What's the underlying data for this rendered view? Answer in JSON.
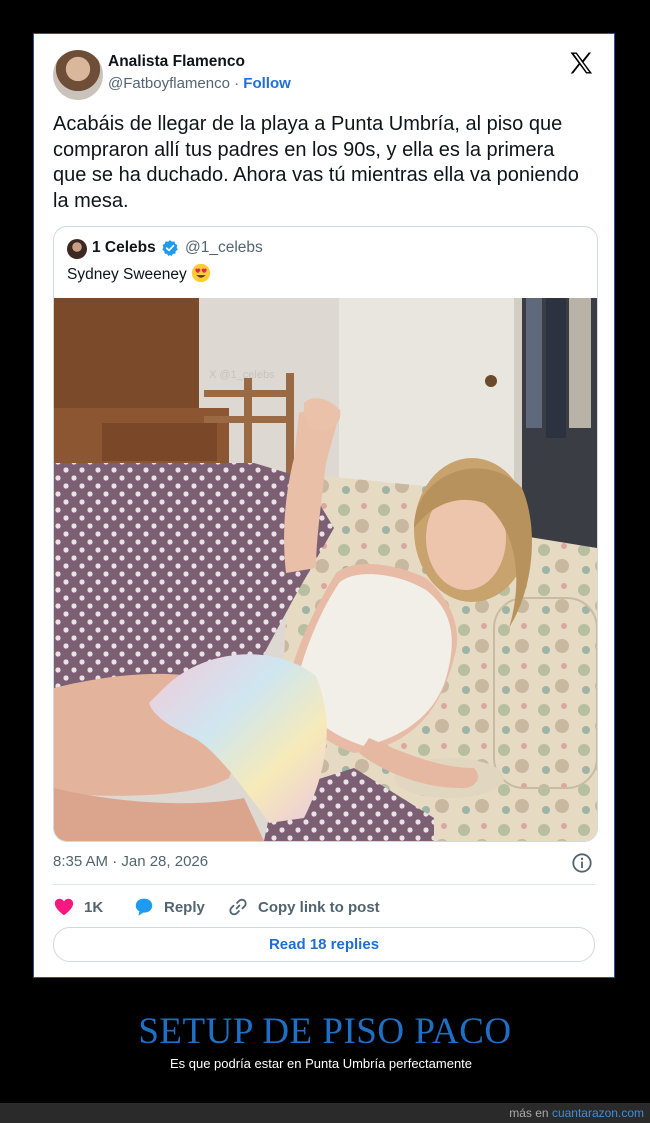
{
  "tweet": {
    "author_name": "Analista Flamenco",
    "author_handle": "@Fatboyflamenco",
    "separator": " · ",
    "follow_label": "Follow",
    "text": "Acabáis de llegar de la playa a Punta Umbría, al piso que compraron allí tus padres en los 90s, y ella es la primera que se ha duchado. Ahora vas tú mientras ella va poniendo la mesa.",
    "quote": {
      "author_name": "1 Celebs",
      "author_handle": "@1_celebs",
      "text": "Sydney Sweeney",
      "emoji": "heart-eyes-emoji",
      "photo_watermark": "X @1_celebs"
    },
    "timestamp": "8:35 AM · Jan 28, 2026",
    "actions": {
      "like_count": "1K",
      "reply_label": "Reply",
      "copy_label": "Copy link to post"
    },
    "read_replies_label": "Read 18 replies",
    "colors": {
      "link": "#1d6fd6",
      "like": "#f91880",
      "verified": "#1d9bf0"
    }
  },
  "caption": {
    "title": "SETUP DE PISO PACO",
    "subtitle": "Es que podría estar en Punta Umbría perfectamente"
  },
  "footer": {
    "prefix": "más en ",
    "site": "cuantarazon.com"
  }
}
